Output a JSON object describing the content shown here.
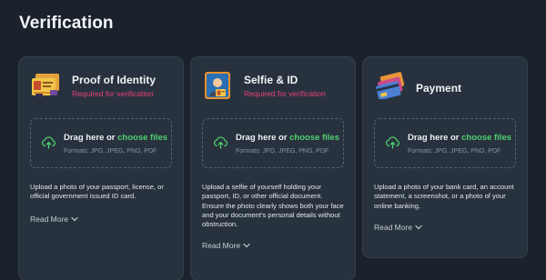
{
  "page": {
    "title": "Verification"
  },
  "cards": [
    {
      "title": "Proof of Identity",
      "subtitle": "Required for verification",
      "drop_prefix": "Drag here or ",
      "drop_link": "choose files",
      "formats": "Formats: JPG, JPEG, PNG, PDF",
      "description": "Upload a photo of your passport, license, or official government issued ID card.",
      "read_more": "Read More"
    },
    {
      "title": "Selfie & ID",
      "subtitle": "Required for verification",
      "drop_prefix": "Drag here or ",
      "drop_link": "choose files",
      "formats": "Formats: JPG, JPEG, PNG, PDF",
      "description": "Upload a selfie of yourself holding your passport, ID, or other official document. Ensure the photo clearly shows both your face and your document's personal details without obstruction.",
      "read_more": "Read More"
    },
    {
      "title": "Payment",
      "drop_prefix": "Drag here or ",
      "drop_link": "choose files",
      "formats": "Formats: JPG, JPEG, PNG, PDF",
      "description": "Upload a photo of your bank card, an account statement, a screenshot, or a photo of your online banking.",
      "read_more": "Read More"
    }
  ],
  "colors": {
    "background": "#1b222b",
    "card": "#28323e",
    "required": "#e8407a",
    "link": "#4fd06f"
  },
  "icons": [
    "id-card-icon",
    "selfie-id-icon",
    "payment-card-icon",
    "cloud-upload-icon",
    "chevron-down-icon"
  ]
}
